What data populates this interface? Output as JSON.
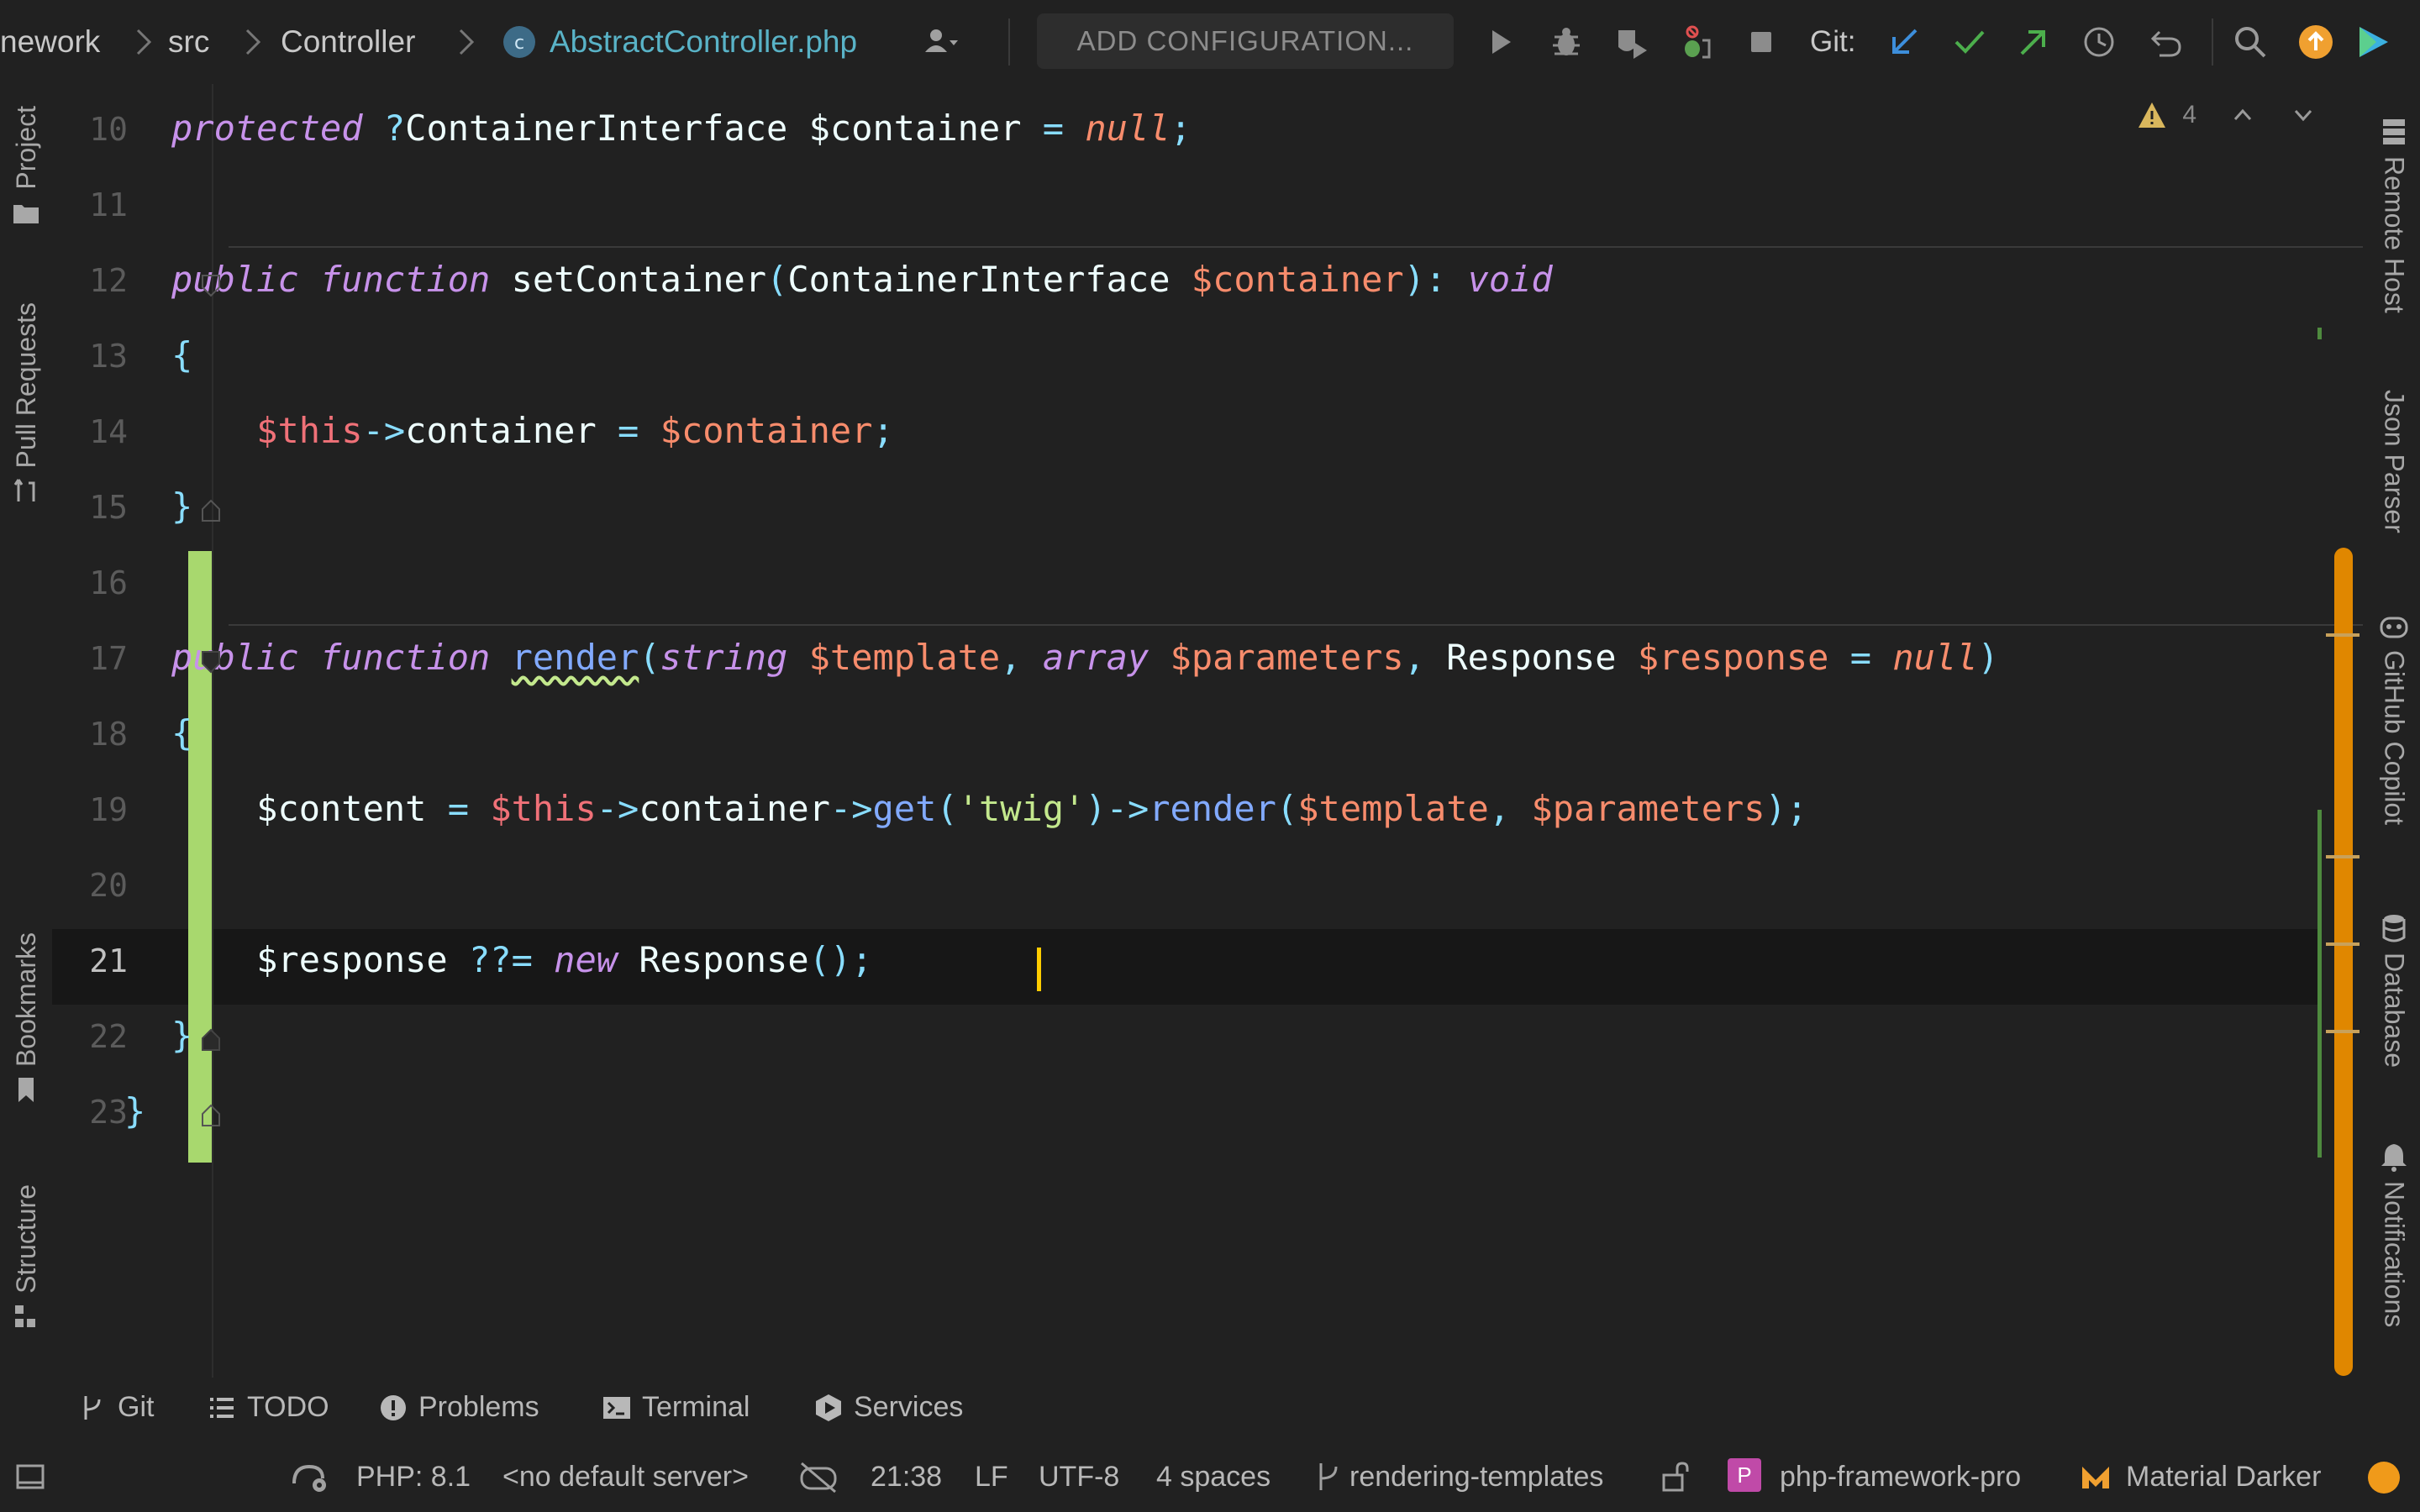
{
  "breadcrumb": {
    "items": [
      "nework",
      "src",
      "Controller",
      "AbstractController.php"
    ]
  },
  "toolbar": {
    "config_label": "ADD CONFIGURATION...",
    "git_label": "Git:"
  },
  "left_tabs": [
    "Project",
    "Pull Requests",
    "Bookmarks",
    "Structure"
  ],
  "right_tabs": [
    "Remote Host",
    "Json Parser",
    "GitHub Copilot",
    "Database",
    "Notifications"
  ],
  "editor": {
    "inspection_count": "4",
    "current_line": 21,
    "line_numbers": [
      "10",
      "11",
      "12",
      "13",
      "14",
      "15",
      "16",
      "17",
      "18",
      "19",
      "20",
      "21",
      "22",
      "23"
    ],
    "lines": [
      [
        [
          "kw",
          "protected"
        ],
        [
          "plain",
          " "
        ],
        [
          "op",
          "?"
        ],
        [
          "typ",
          "ContainerInterface"
        ],
        [
          "plain",
          " "
        ],
        [
          "plain",
          "$container"
        ],
        [
          "plain",
          " "
        ],
        [
          "op",
          "="
        ],
        [
          "plain",
          " "
        ],
        [
          "nul",
          "null"
        ],
        [
          "op",
          ";"
        ]
      ],
      [],
      [
        [
          "kw",
          "public"
        ],
        [
          "plain",
          " "
        ],
        [
          "kw",
          "function"
        ],
        [
          "plain",
          " setContainer"
        ],
        [
          "op",
          "("
        ],
        [
          "typ",
          "ContainerInterface"
        ],
        [
          "plain",
          " "
        ],
        [
          "prm",
          "$container"
        ],
        [
          "op",
          "):"
        ],
        [
          "plain",
          " "
        ],
        [
          "kw",
          "void"
        ]
      ],
      [
        [
          "brace",
          "{"
        ]
      ],
      [
        [
          "plain",
          "    "
        ],
        [
          "var",
          "$this"
        ],
        [
          "op",
          "->"
        ],
        [
          "plain",
          "container"
        ],
        [
          "plain",
          " "
        ],
        [
          "op",
          "="
        ],
        [
          "plain",
          " "
        ],
        [
          "prm",
          "$container"
        ],
        [
          "op",
          ";"
        ]
      ],
      [
        [
          "brace",
          "}"
        ]
      ],
      [],
      [
        [
          "kw",
          "public"
        ],
        [
          "plain",
          " "
        ],
        [
          "kw",
          "function"
        ],
        [
          "plain",
          " "
        ],
        [
          "fn-wavy",
          "render"
        ],
        [
          "op",
          "("
        ],
        [
          "kw",
          "string"
        ],
        [
          "plain",
          " "
        ],
        [
          "prm",
          "$template"
        ],
        [
          "op",
          ","
        ],
        [
          "plain",
          " "
        ],
        [
          "kw",
          "array"
        ],
        [
          "plain",
          " "
        ],
        [
          "prm",
          "$parameters"
        ],
        [
          "op",
          ","
        ],
        [
          "plain",
          " Response "
        ],
        [
          "prm",
          "$response"
        ],
        [
          "plain",
          " "
        ],
        [
          "op",
          "="
        ],
        [
          "plain",
          " "
        ],
        [
          "nul",
          "null"
        ],
        [
          "op",
          ")"
        ]
      ],
      [
        [
          "brace",
          "{"
        ]
      ],
      [
        [
          "plain",
          "    $content "
        ],
        [
          "op",
          "="
        ],
        [
          "plain",
          " "
        ],
        [
          "var",
          "$this"
        ],
        [
          "op",
          "->"
        ],
        [
          "plain",
          "container"
        ],
        [
          "op",
          "->"
        ],
        [
          "fn",
          "get"
        ],
        [
          "op",
          "("
        ],
        [
          "str",
          "'twig'"
        ],
        [
          "op",
          ")->"
        ],
        [
          "fn",
          "render"
        ],
        [
          "op",
          "("
        ],
        [
          "prm",
          "$template"
        ],
        [
          "op",
          ","
        ],
        [
          "plain",
          " "
        ],
        [
          "prm",
          "$parameters"
        ],
        [
          "op",
          ");"
        ]
      ],
      [],
      [
        [
          "plain",
          "    $response "
        ],
        [
          "op",
          "??="
        ],
        [
          "plain",
          " "
        ],
        [
          "kw",
          "new"
        ],
        [
          "plain",
          " Response"
        ],
        [
          "op",
          "();"
        ]
      ],
      [
        [
          "brace",
          "}"
        ]
      ],
      [
        [
          "brace",
          "}"
        ]
      ]
    ]
  },
  "bottom_tabs": [
    "Git",
    "TODO",
    "Problems",
    "Terminal",
    "Services"
  ],
  "status": {
    "php": "PHP: 8.1",
    "server": "<no default server>",
    "position": "21:38",
    "line_sep": "LF",
    "encoding": "UTF-8",
    "indent": "4 spaces",
    "branch": "rendering-templates",
    "project_badge": "P",
    "project": "php-framework-pro",
    "theme": "Material Darker"
  },
  "colors": {
    "accent_orange": "#e08700",
    "vcs_added": "#a8d86e",
    "caret": "#ffcc00"
  }
}
